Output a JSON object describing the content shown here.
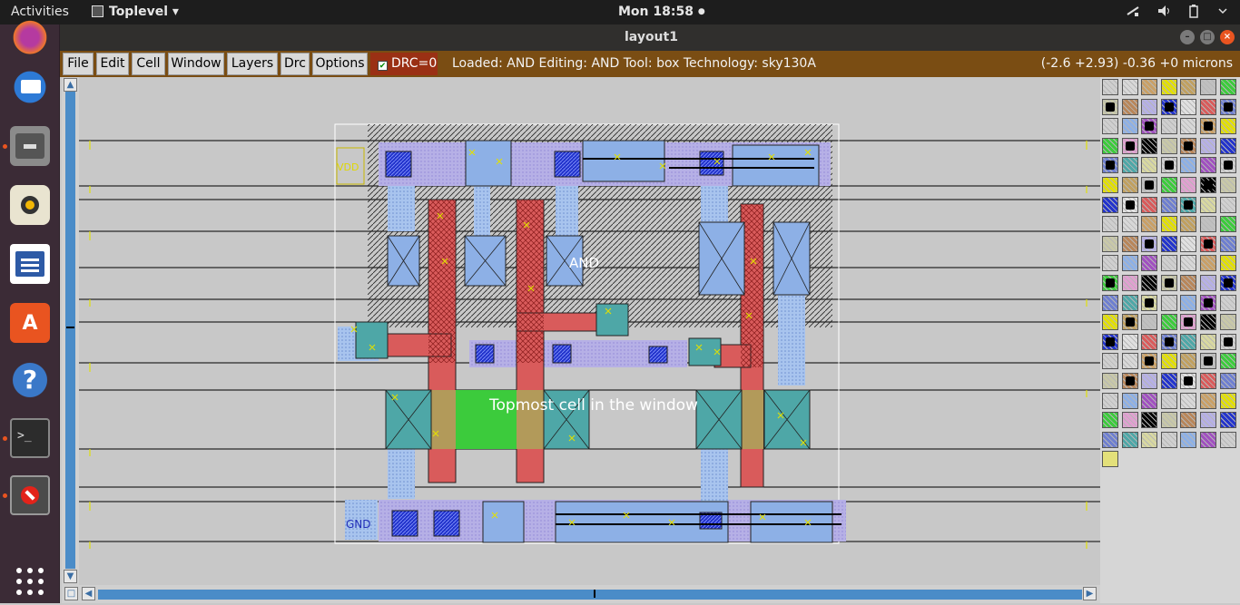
{
  "top_bar": {
    "activities": "Activities",
    "app_name": "Toplevel",
    "app_arrow": "▾",
    "clock": "Mon 18:58",
    "clock_dot": "●"
  },
  "window": {
    "title": "layout1"
  },
  "menu": {
    "file": "File",
    "edit": "Edit",
    "cell": "Cell",
    "window": "Window",
    "layers": "Layers",
    "drc": "Drc",
    "options": "Options"
  },
  "drc": {
    "label": "DRC=0",
    "checked": true
  },
  "status": {
    "text": "Loaded: AND Editing: AND Tool: box  Technology: sky130A",
    "coords": "(-2.6 +2.93) -0.36 +0 microns"
  },
  "layout": {
    "cell_name": "AND",
    "vdd_label": "VDD",
    "gnd_label": "GND",
    "tooltip": "Topmost cell in the window"
  },
  "colors": {
    "accent": "#7a4d13",
    "drc_bg": "#9a3014",
    "dock_bg": "#3b2b36",
    "scroll": "#4a8cc8"
  },
  "dock_icons": [
    "firefox-icon",
    "thunderbird-icon",
    "files-icon",
    "rhythmbox-icon",
    "writer-icon",
    "software-icon",
    "help-icon",
    "terminal-icon",
    "error-icon",
    "app-grid-icon"
  ]
}
